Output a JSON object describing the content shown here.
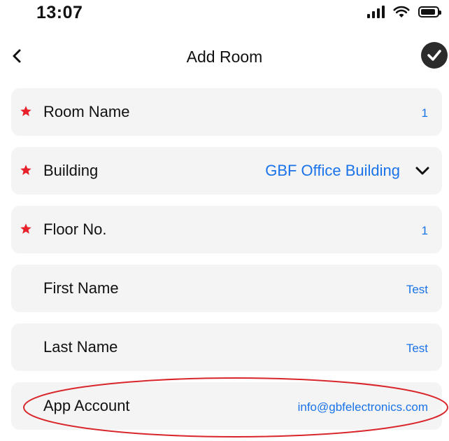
{
  "status_bar": {
    "time": "13:07"
  },
  "nav": {
    "title": "Add Room"
  },
  "form": {
    "rows": [
      {
        "label": "Room Name",
        "value": "1",
        "required": true
      },
      {
        "label": "Building",
        "value": "GBF Office Building",
        "required": true
      },
      {
        "label": "Floor No.",
        "value": "1",
        "required": true
      },
      {
        "label": "First Name",
        "value": "Test",
        "required": false
      },
      {
        "label": "Last Name",
        "value": "Test",
        "required": false
      },
      {
        "label": "App Account",
        "value": "info@gbfelectronics.com",
        "required": false
      }
    ]
  },
  "colors": {
    "accent": "#1a73e8",
    "required_star": "#e8202a",
    "row_bg": "#f4f4f4",
    "highlight_ellipse": "#d9262b"
  },
  "icons": {
    "back": "chevron-left",
    "confirm": "check-circle",
    "dropdown": "chevron-down",
    "required": "star"
  }
}
